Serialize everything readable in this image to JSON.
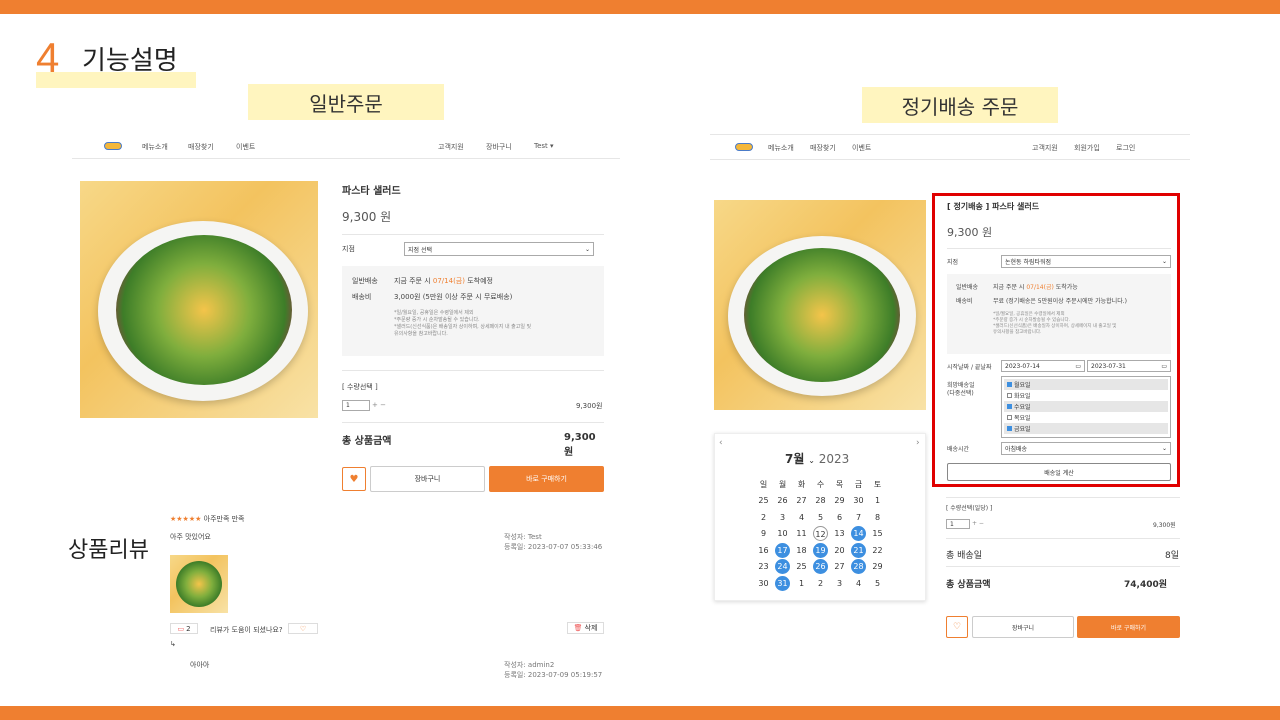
{
  "slide": {
    "number": "4",
    "title": "기능설명",
    "label_normal": "일반주문",
    "label_subscription": "정기배송 주문",
    "label_review": "상품리뷰"
  },
  "left": {
    "nav": {
      "menu1": "메뉴소개",
      "menu2": "매장찾기",
      "menu3": "이벤트",
      "support": "고객지원",
      "cart": "장바구니",
      "user": "Test ▾"
    },
    "product": {
      "name": "파스타 샐러드",
      "price": "9,300 원",
      "store_label": "지점",
      "store_select": "지점 선택",
      "delivery_label": "일반배송",
      "delivery_prefix": "지금 주문 시 ",
      "delivery_date": "07/14(금)",
      "delivery_suffix": " 도착예정",
      "fee_label": "배송비",
      "fee_value": "3,000원 (5만원 이상 주문 시 무료배송)",
      "note1": "*일/월요일, 공휴일은 수령일에서 제외",
      "note2": "*주문량 증가 시 순차발송될 수 있습니다.",
      "note3": "*샐러드(신선식품)은 배송일자 상이하며, 상세페이지 내 출고일 및",
      "note4": "유의사항을 참고바랍니다.",
      "qty_label": "[ 수량선택 ]",
      "qty": "1",
      "qty_price": "9,300원",
      "total_label": "총 상품금액",
      "total": "9,300원",
      "cart_btn": "장바구니",
      "buy_btn": "바로 구매하기"
    },
    "review": {
      "stars": "★★★★★",
      "rating_text": "아주만족 만족",
      "comment": "아주 맛있어요",
      "author": "작성자: Test",
      "date": "등록일: 2023-07-07 05:33:46",
      "comment_count": "2",
      "helpful": "리뷰가 도움이 되셨나요?",
      "delete": "삭제",
      "reply_arrow": "↳",
      "reply": "아아아",
      "reply_author": "작성자: admin2",
      "reply_date": "등록일: 2023-07-09 05:19:57"
    }
  },
  "right": {
    "nav": {
      "menu1": "메뉴소개",
      "menu2": "매장찾기",
      "menu3": "이벤트",
      "support": "고객지원",
      "join": "회원가입",
      "login": "로그인"
    },
    "product": {
      "name": "[ 정기배송 ] 파스타 샐러드",
      "price": "9,300 원",
      "store_label": "지점",
      "store_select": "논현동 하림타워점",
      "delivery_label": "일반배송",
      "delivery_prefix": "지금 주문 시 ",
      "delivery_date": "07/14(금)",
      "delivery_suffix": " 도착가능",
      "fee_label": "배송비",
      "fee_value": "무료 (정기배송은 5만원이상 주문시에만 가능합니다.)",
      "note1": "*일/월요일, 공휴일은 수령일에서 제외",
      "note2": "*주문량 증가 시 순차발송될 수 있습니다.",
      "note3": "*샐러드(신선식품)은 배송일자 상이하며, 상세페이지 내 출고일 및",
      "note4": "유의사항을 참고바랍니다.",
      "period_label": "시작날짜 / 끝날짜",
      "start_date": "2023-07-14",
      "end_date": "2023-07-31",
      "days_label1": "희망배송일",
      "days_label2": "(다중선택)",
      "days": [
        {
          "label": "월요일",
          "checked": true
        },
        {
          "label": "화요일",
          "checked": false
        },
        {
          "label": "수요일",
          "checked": true
        },
        {
          "label": "목요일",
          "checked": false
        },
        {
          "label": "금요일",
          "checked": true
        }
      ],
      "time_label": "배송시간",
      "time_select": "아침배송",
      "calc_btn": "배송일 계산",
      "qty_label": "[ 수량선택(일당) ]",
      "qty": "1",
      "qty_price": "9,300원",
      "days_total_label": "총 배송일",
      "days_total": "8일",
      "total_label": "총 상품금액",
      "total": "74,400원",
      "cart_btn": "장바구니",
      "buy_btn": "바로 구매하기"
    },
    "calendar": {
      "month": "7월",
      "year": "2023",
      "weekdays": [
        "일",
        "월",
        "화",
        "수",
        "목",
        "금",
        "토"
      ],
      "weeks": [
        [
          "25",
          "26",
          "27",
          "28",
          "29",
          "30",
          "1"
        ],
        [
          "2",
          "3",
          "4",
          "5",
          "6",
          "7",
          "8"
        ],
        [
          "9",
          "10",
          "11",
          "12",
          "13",
          "14",
          "15"
        ],
        [
          "16",
          "17",
          "18",
          "19",
          "20",
          "21",
          "22"
        ],
        [
          "23",
          "24",
          "25",
          "26",
          "27",
          "28",
          "29"
        ],
        [
          "30",
          "31",
          "1",
          "2",
          "3",
          "4",
          "5"
        ]
      ],
      "selected": [
        "14",
        "17",
        "19",
        "21",
        "24",
        "26",
        "28",
        "31"
      ],
      "today": "12"
    }
  },
  "colors": {
    "accent": "#ef7f30",
    "selected": "#3d8fe0",
    "highlight": "#fff5bf",
    "frame": "#e00000"
  }
}
